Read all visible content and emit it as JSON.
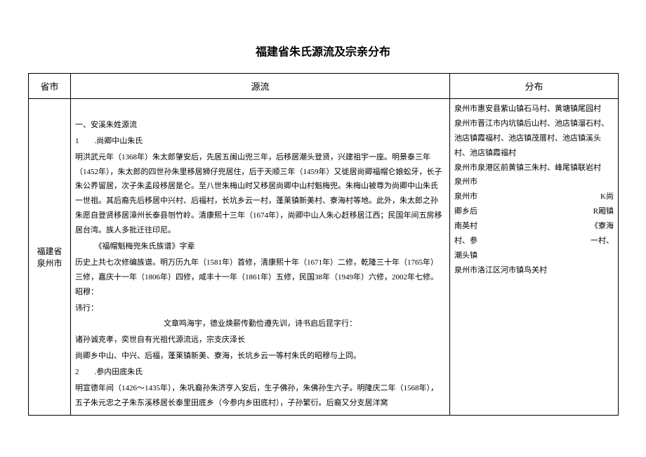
{
  "title": "福建省朱氏源流及宗亲分布",
  "headers": {
    "province": "省市",
    "origin": "源流",
    "distribution": "分布"
  },
  "row": {
    "province": "福建省泉州市",
    "origin": {
      "p1": "一、安溪朱姓源流",
      "p2": "1　　.尚卿中山朱氏",
      "p3": "明洪武元年（1368年）朱太郎肇安后，先居五闽山兜三年，后移居潮头登贤，兴建祖宇一座。明景泰三年（1452年），朱太郎的四世孙朱里移居狮仔兜居住，后于天顺三年（1459年）又徙居尚卿福帽仑娘蚣牙，长子朱公养留居，次子朱孟段移居是仑。至八世朱梅山时又移居尚卿中山村魁梅兜。朱梅山被尊为尚卿中山朱氏一世祖。其后裔先后移居中兴村、后福村，长坑乡云一村，蓬莱镇新美村、寮海村等地。此外，朱太郎之孙朱愿自登贤移居漳州长泰县刎竹岭。清康熙十三年（1674年），尚卿中山人朱心赶移居江西；民国年间五房移居台湾。族人多批迁往印尼。",
      "p4": "　　　《福帽魁梅兜朱氏族谱》字辈",
      "p5": "历史上共七次修编族谱。明万历九年（1581年）首修，清康熙十年（1671年）二修，乾隆三十年（1765年）三修，嘉庆十一年（1806年）四修，咸丰十一年（1861年）五修，民国38年（1949年）六修，2002年七修。昭穆：",
      "p6": "讳行：",
      "p7": "文章鸣海宇，德业焕薪传勤俭遵先训，诗书启后昆字行：",
      "p8": "诸孙诚克孝，奕世自有光祖代源流远，宗支庆泽长",
      "p9": "尚卿乡中山、中兴、后福，蓬莱镇新美、寮海，长坑乡云一等村朱氏的昭穆与上同。",
      "p10": "2　　.参内田底朱氏",
      "p11": "明宣德年间（1426～1435年），朱巩裔孙朱济亨入安后，生子佛孙，朱佛孙生六子。明隆庆二年（1568年），五子朱元忠之子朱东溪移居长泰里田底乡（今参内乡田底村），子孙繁衍。后裔又分支居洋窝"
    },
    "distribution": {
      "d1": "泉州市惠安县紫山镇石马村、黄塘镇尾园村",
      "d2": "泉州市晋江市内坑镇后山村、池店镇溜石村、池店镇霞福村、池店镇茂厝村、池店镇溪头村、池店镇霞福村",
      "d3": "泉州市泉港区前黄镇三朱村、峰尾镇联岩村",
      "d4": "泉州市",
      "d5": "泉州市",
      "d5r": "K尚",
      "d6": "卿乡后",
      "d6r": "R厢镇",
      "d7": "南英村",
      "d7r": "《寮海",
      "d8": "村、参",
      "d8r": "一村、",
      "d9": "潮头镇",
      "d10": "泉州市洛江区河市镇鸟关村"
    }
  }
}
